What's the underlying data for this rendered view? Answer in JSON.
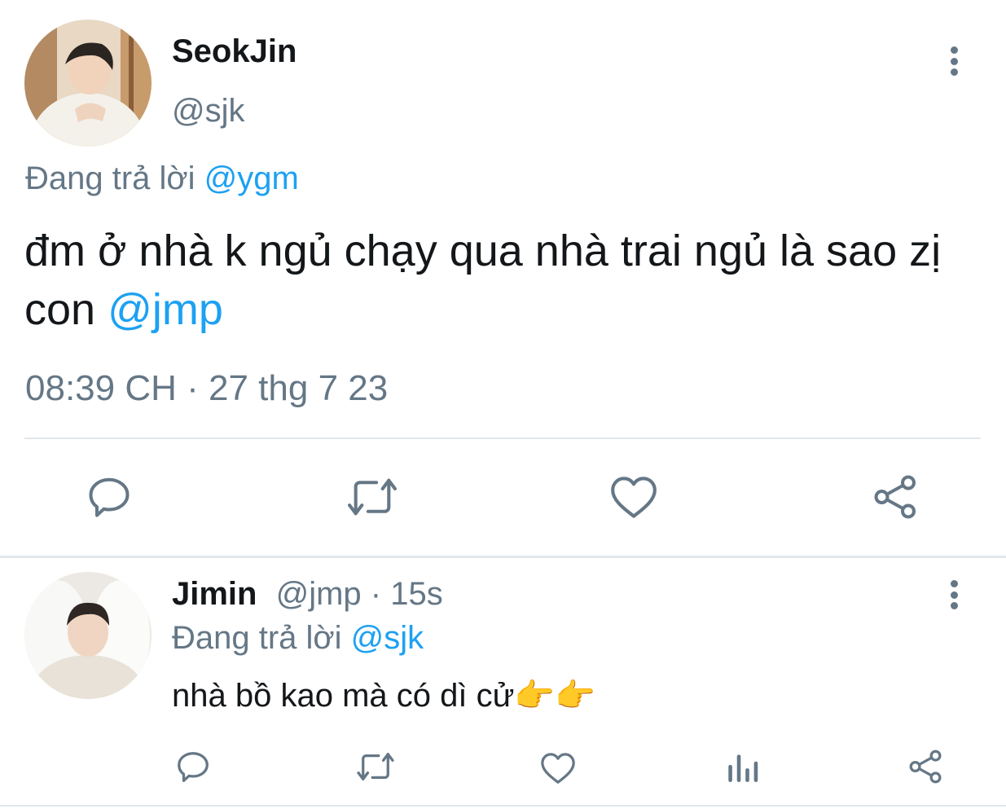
{
  "main_tweet": {
    "author_name": "SeokJin",
    "author_handle": "@sjk",
    "reply_prefix": "Đang trả lời",
    "reply_to": "@ygm",
    "text": "đm ở nhà k ngủ chạy qua nhà trai ngủ là sao zị con",
    "mention": "@jmp",
    "time": "08:39 CH",
    "separator": "·",
    "date": "27 thg 7 23",
    "actions": [
      "reply-icon",
      "retweet-icon",
      "like-icon",
      "share-icon"
    ]
  },
  "reply_tweet": {
    "author_name": "Jimin",
    "author_handle": "@jmp",
    "separator": "·",
    "age": "15s",
    "reply_prefix": "Đang trả lời",
    "reply_to": "@sjk",
    "text": "nhà bồ kao mà có dì cử",
    "emoji": "👉👉",
    "actions": [
      "reply-icon",
      "retweet-icon",
      "like-icon",
      "analytics-icon",
      "share-icon"
    ]
  },
  "colors": {
    "accent": "#1da1f2",
    "muted": "#657786",
    "text": "#14171a",
    "divider": "#e1e8ed"
  }
}
